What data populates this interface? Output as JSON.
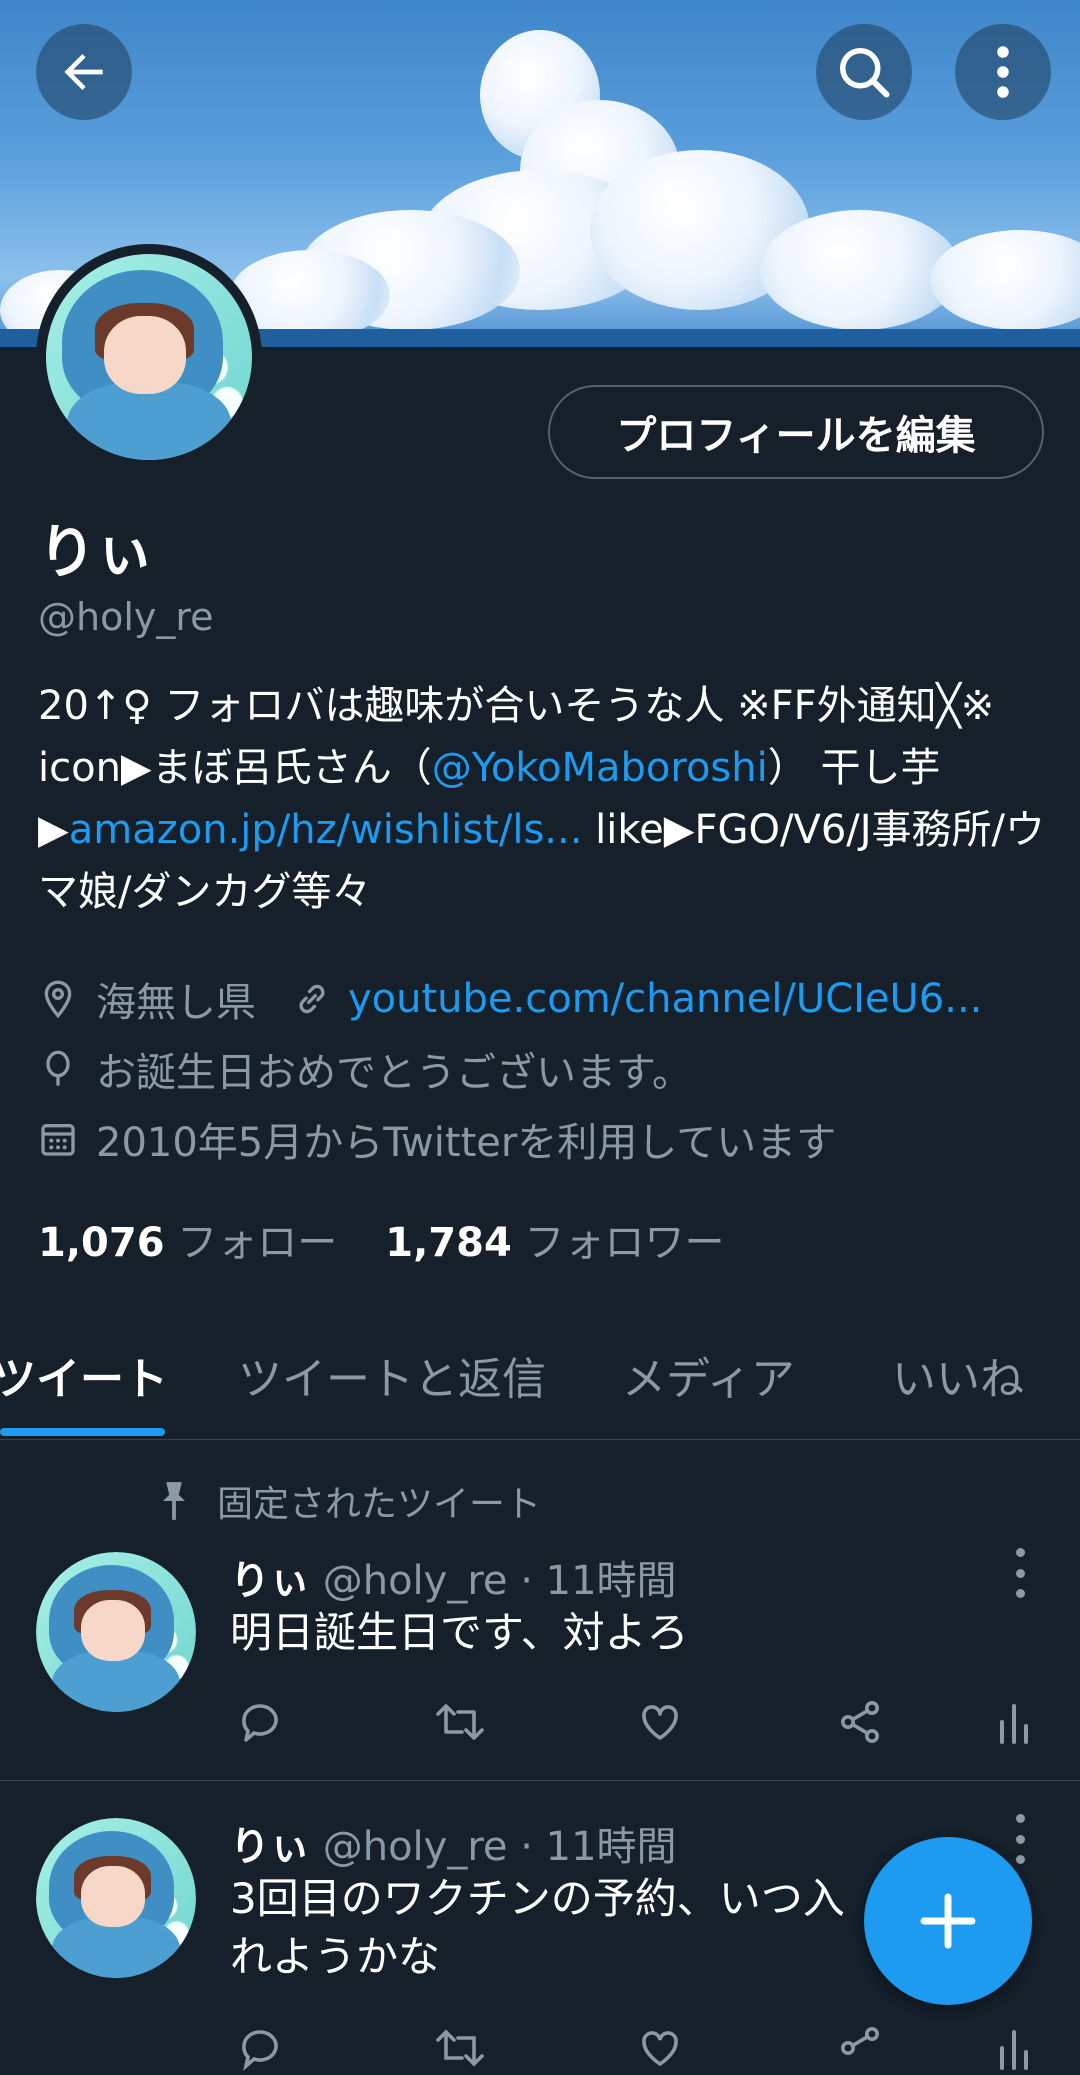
{
  "profile": {
    "display_name": "りぃ",
    "handle": "@holy_re",
    "edit_button_label": "プロフィールを編集",
    "bio": {
      "part1": "20↑♀ フォロバは趣味が合いそうな人 ※FF外通知╳※ icon▶まぼ呂氏さん（",
      "mention": "@YokoMaboroshi",
      "part2": "） 干し芋▶",
      "wishlist_link": "amazon.jp/hz/wishlist/ls...",
      "part3": " like▶FGO/V6/J事務所/ウマ娘/ダンカグ等々"
    },
    "location": "海無し県",
    "website": "youtube.com/channel/UCIeU6...",
    "birthday": "お誕生日おめでとうございます。",
    "joined": "2010年5月からTwitterを利用しています",
    "following_count": "1,076",
    "following_label": "フォロー",
    "followers_count": "1,784",
    "followers_label": "フォロワー"
  },
  "tabs": [
    {
      "label": "ツイート",
      "active": true
    },
    {
      "label": "ツイートと返信",
      "active": false
    },
    {
      "label": "メディア",
      "active": false
    },
    {
      "label": "いいね",
      "active": false
    }
  ],
  "pinned_label": "固定されたツイート",
  "tweets": [
    {
      "name": "りぃ",
      "meta": "@holy_re · 11時間",
      "text": "明日誕生日です、対よろ"
    },
    {
      "name": "りぃ",
      "meta": "@holy_re · 11時間",
      "text": "3回目のワクチンの予約、いつ入れようかな"
    }
  ],
  "icons": {
    "back": "back-arrow-icon",
    "search": "search-icon",
    "more": "more-vertical-icon",
    "location": "location-pin-icon",
    "link": "link-icon",
    "birthday": "balloon-icon",
    "calendar": "calendar-icon",
    "pin": "pin-icon",
    "reply": "reply-icon",
    "retweet": "retweet-icon",
    "like": "heart-icon",
    "share": "share-icon",
    "analytics": "analytics-icon",
    "compose": "plus-icon"
  },
  "colors": {
    "background": "#15202b",
    "accent": "#1d9bf0",
    "muted_text": "#8b98a5",
    "divider": "#38444d"
  }
}
